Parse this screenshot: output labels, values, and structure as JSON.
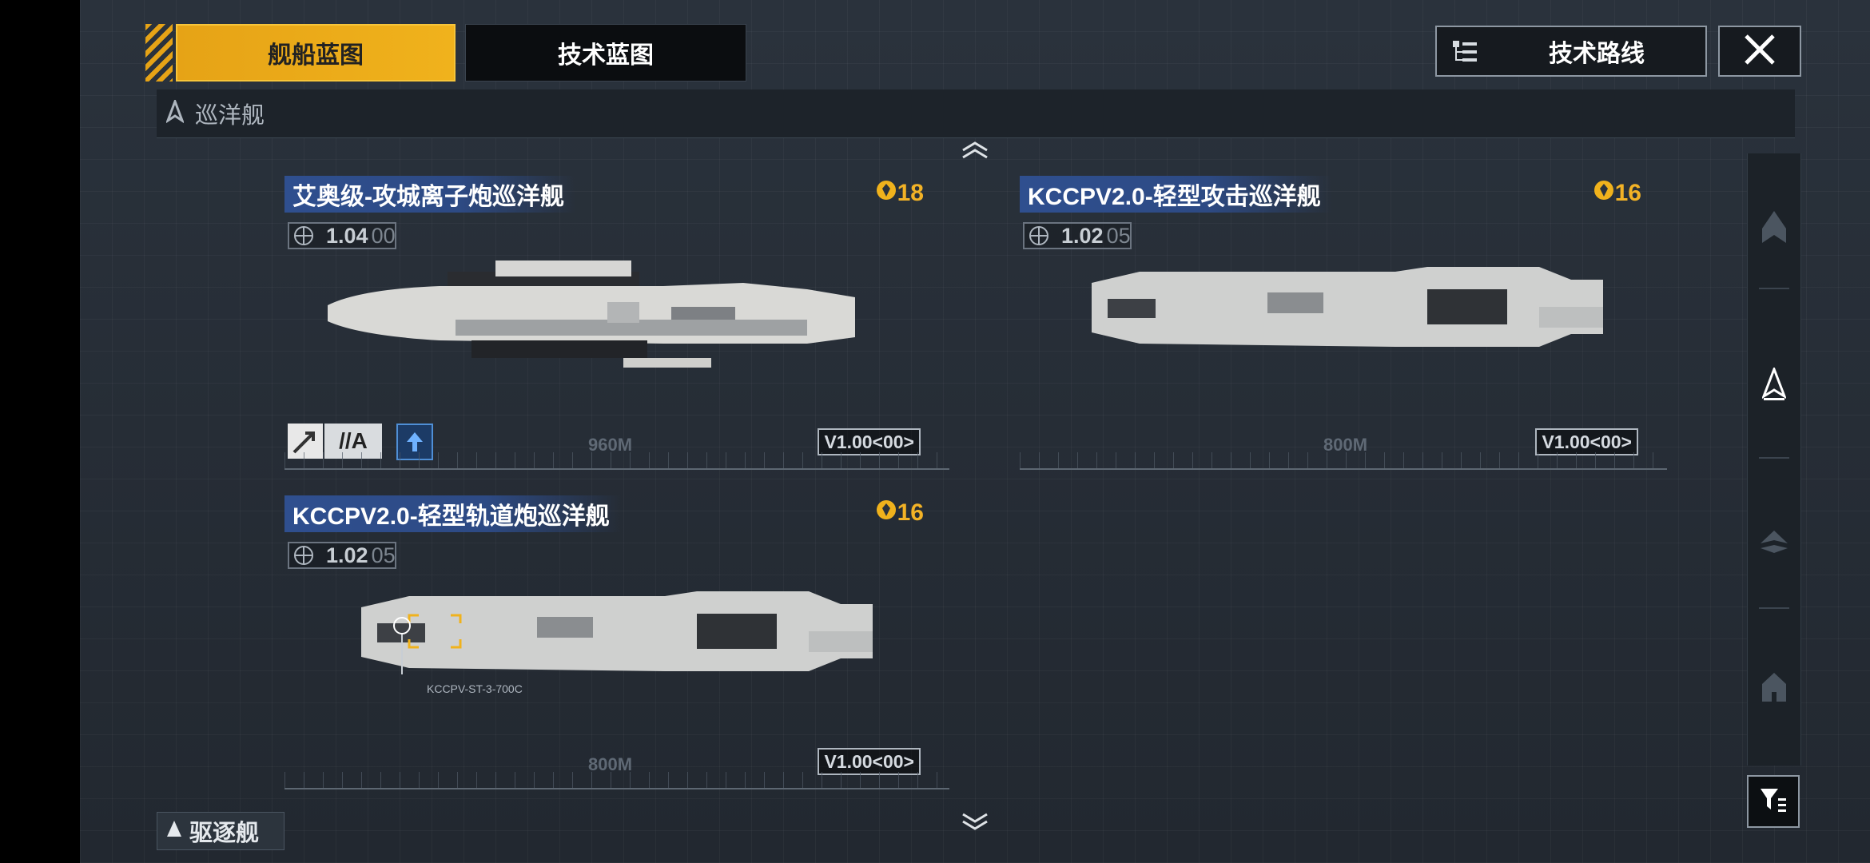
{
  "tabs": {
    "ship_blueprint": "舰船蓝图",
    "tech_blueprint": "技术蓝图"
  },
  "header": {
    "tech_route": "技术路线"
  },
  "category": {
    "current": "巡洋舰",
    "next": "驱逐舰"
  },
  "ships": [
    {
      "name": "艾奥级-攻城离子炮巡洋舰",
      "cost": "18",
      "version_major": "1.04",
      "version_minor": "00",
      "build": "V1.00<00>",
      "length": "960M",
      "module_label": "//A"
    },
    {
      "name": "KCCPV2.0-轻型攻击巡洋舰",
      "cost": "16",
      "version_major": "1.02",
      "version_minor": "05",
      "build": "V1.00<00>",
      "length": "800M"
    },
    {
      "name": "KCCPV2.0-轻型轨道炮巡洋舰",
      "cost": "16",
      "version_major": "1.02",
      "version_minor": "05",
      "build": "V1.00<00>",
      "length": "800M",
      "part_label": "KCCPV-ST-3-700C"
    }
  ],
  "colors": {
    "accent": "#F0B21C",
    "title_bar": "#2F4F8F",
    "background": "#262D36"
  },
  "icons": {
    "route": "tech-tree-icon",
    "close": "close-icon",
    "category": "cruiser-icon",
    "cost": "gear-badge-icon",
    "filter": "filter-icon",
    "scroll_up": "chevron-up-icon",
    "scroll_down": "chevron-down-icon"
  }
}
